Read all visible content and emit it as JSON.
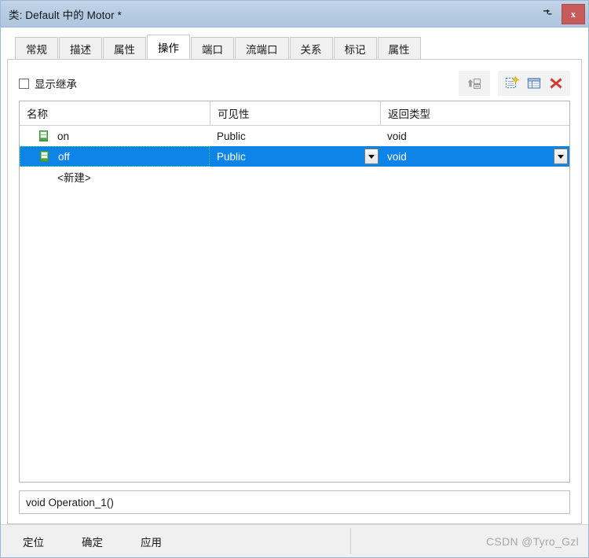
{
  "window": {
    "title": "类: Default 中的 Motor *",
    "pin_icon": "pin-icon",
    "close_label": "x"
  },
  "tabs": [
    {
      "label": "常规",
      "active": false
    },
    {
      "label": "描述",
      "active": false
    },
    {
      "label": "属性",
      "active": false
    },
    {
      "label": "操作",
      "active": true
    },
    {
      "label": "端口",
      "active": false
    },
    {
      "label": "流端口",
      "active": false
    },
    {
      "label": "关系",
      "active": false
    },
    {
      "label": "标记",
      "active": false
    },
    {
      "label": "属性",
      "active": false
    }
  ],
  "toolbar": {
    "show_inherited_label": "显示继承",
    "show_inherited_checked": false,
    "buttons": [
      {
        "name": "move-up-icon",
        "title": "上移"
      },
      {
        "name": "new-item-icon",
        "title": "新建"
      },
      {
        "name": "properties-icon",
        "title": "属性"
      },
      {
        "name": "delete-icon",
        "title": "删除"
      }
    ]
  },
  "grid": {
    "columns": [
      "名称",
      "可见性",
      "返回类型"
    ],
    "rows": [
      {
        "name": "on",
        "visibility": "Public",
        "return_type": "void",
        "selected": false
      },
      {
        "name": "off",
        "visibility": "Public",
        "return_type": "void",
        "selected": true
      }
    ],
    "new_row_label": "<新建>"
  },
  "signature": {
    "value": "void Operation_1()"
  },
  "footer": {
    "buttons": [
      "定位",
      "确定",
      "应用"
    ],
    "watermark": "CSDN @Tyro_Gzl"
  },
  "colors": {
    "titlebar": "#b6cbe1",
    "selection": "#0f84e8",
    "close": "#c75b5b",
    "op_icon_green": "#5cb85c",
    "delete_red": "#d9352c"
  }
}
